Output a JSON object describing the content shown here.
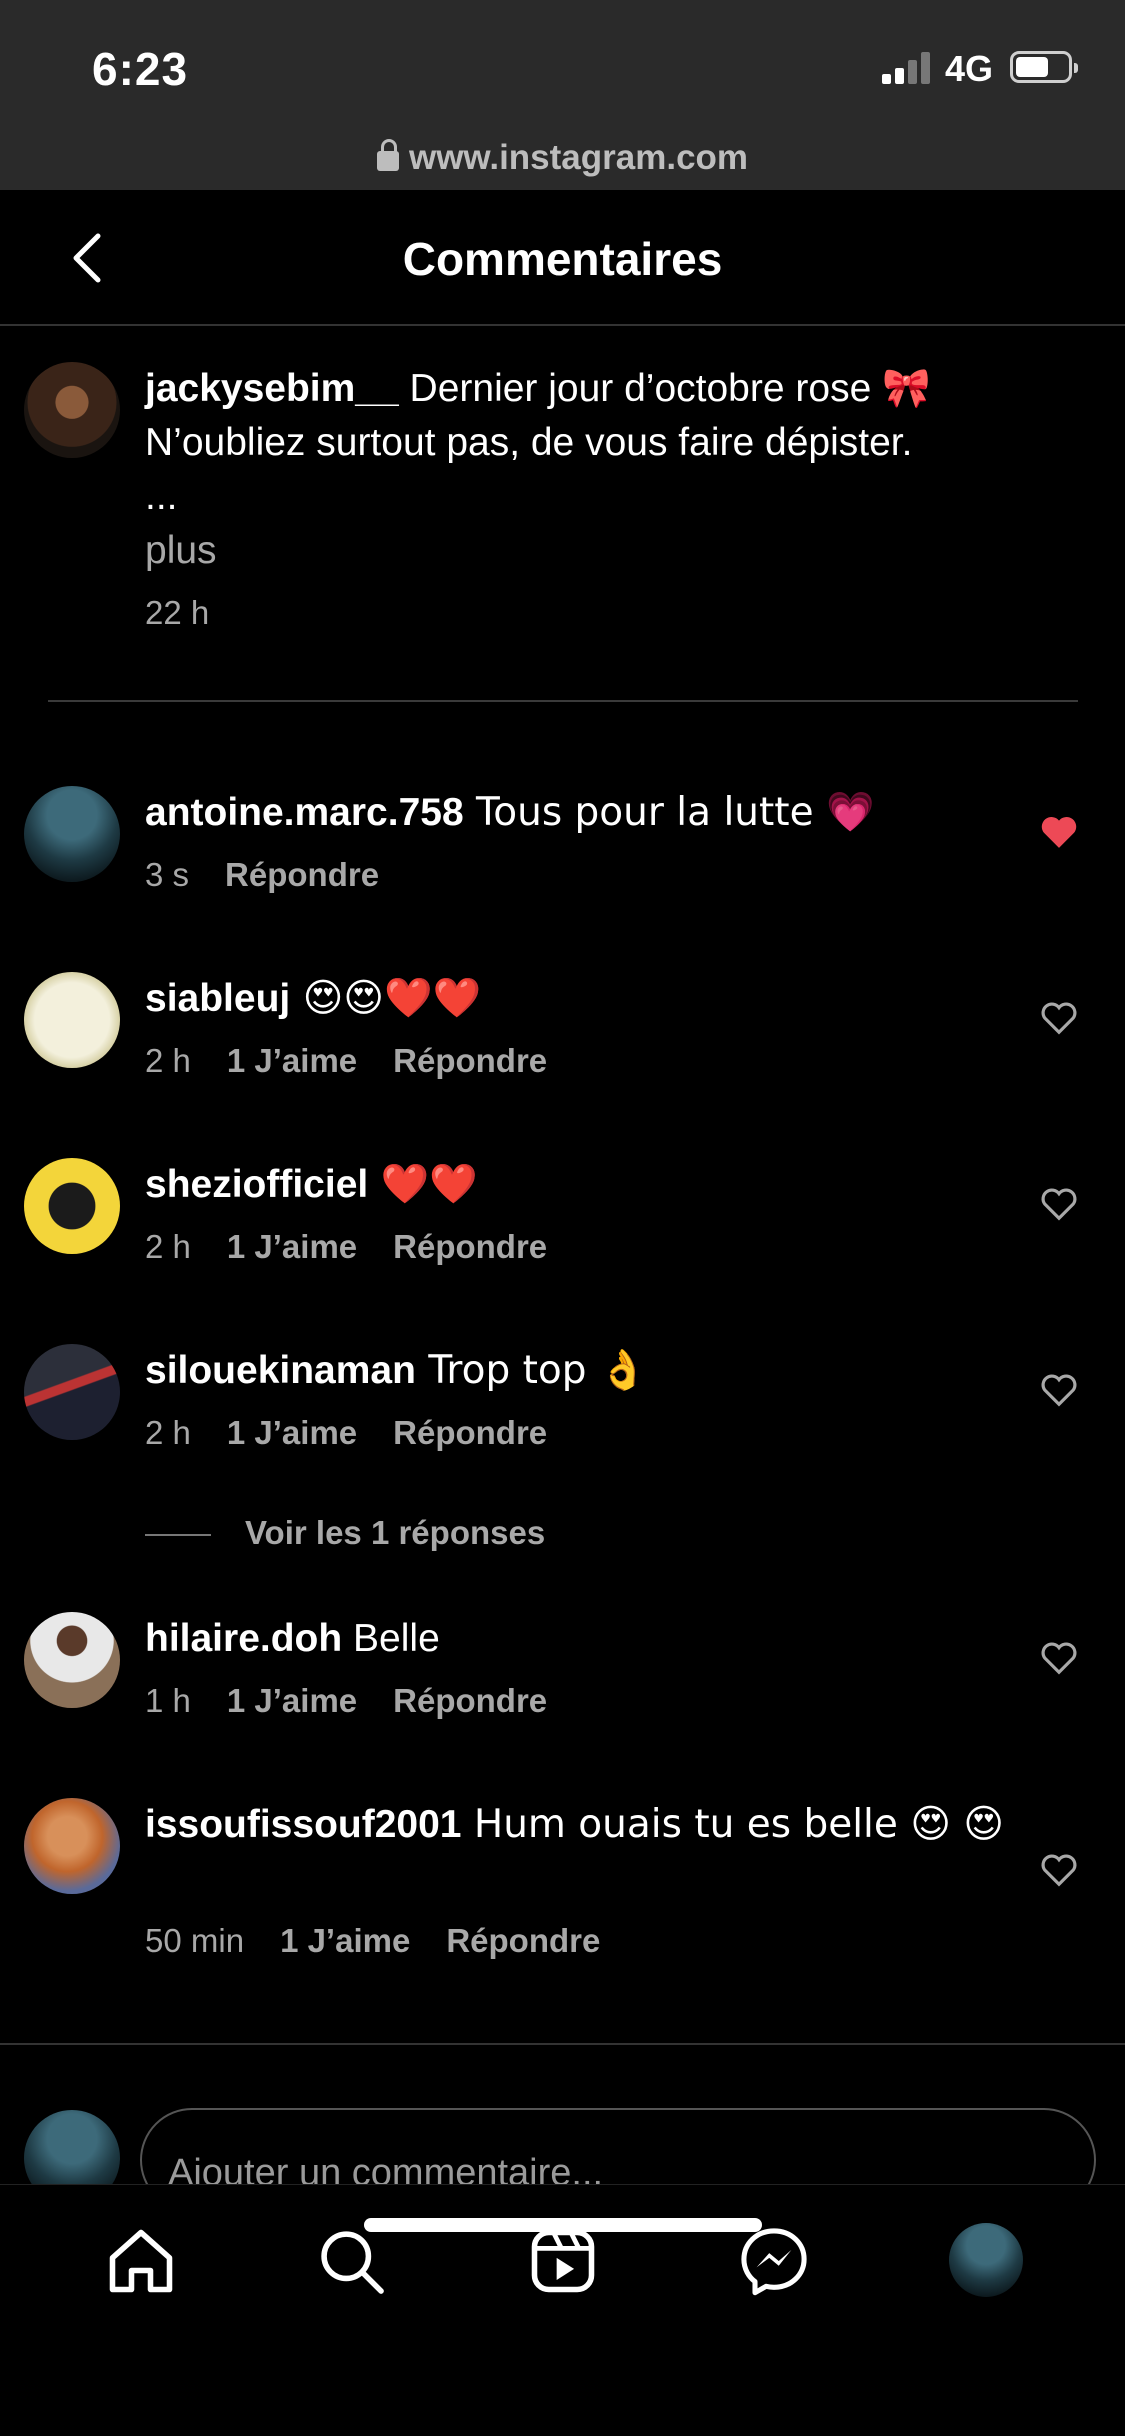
{
  "status_bar": {
    "time": "6:23",
    "network": "4G",
    "url": "www.instagram.com"
  },
  "header": {
    "title": "Commentaires"
  },
  "caption": {
    "username": "jackysebim__",
    "text": " Dernier jour d’octobre rose 🎀",
    "line2": "N’oubliez surtout pas, de vous faire dépister.",
    "ellipsis": "...",
    "more": "plus",
    "time": "22 h"
  },
  "comments": [
    {
      "username": "antoine.marc.758",
      "text": " Tous pour la lutte 💗",
      "time": "3 s",
      "likes": "",
      "reply": "Répondre",
      "liked": true
    },
    {
      "username": "siableuj",
      "text": " 😍😍❤️❤️",
      "time": "2 h",
      "likes": "1 J’aime",
      "reply": "Répondre",
      "liked": false
    },
    {
      "username": "sheziofficiel",
      "text": " ❤️❤️",
      "time": "2 h",
      "likes": "1 J’aime",
      "reply": "Répondre",
      "liked": false
    },
    {
      "username": "silouekinaman",
      "text": " Trop top 👌",
      "time": "2 h",
      "likes": "1 J’aime",
      "reply": "Répondre",
      "liked": false
    },
    {
      "username": "hilaire.doh",
      "text": " Belle",
      "time": "1 h",
      "likes": "1 J’aime",
      "reply": "Répondre",
      "liked": false
    },
    {
      "username": "issoufissouf2001",
      "text": " Hum ouais tu es belle 😍 😍",
      "time": "50 min",
      "likes": "1 J’aime",
      "reply": "Répondre",
      "liked": false
    }
  ],
  "view_replies": "Voir les 1 réponses",
  "add_comment": {
    "placeholder": "Ajouter un commentaire..."
  },
  "tabs": [
    "home-icon",
    "search-icon",
    "reels-icon",
    "messenger-icon",
    "profile-avatar"
  ],
  "colors": {
    "background": "#000000",
    "status_bar": "#2a2a2a",
    "like_red": "#ed4956",
    "muted": "#a8a8a8"
  }
}
